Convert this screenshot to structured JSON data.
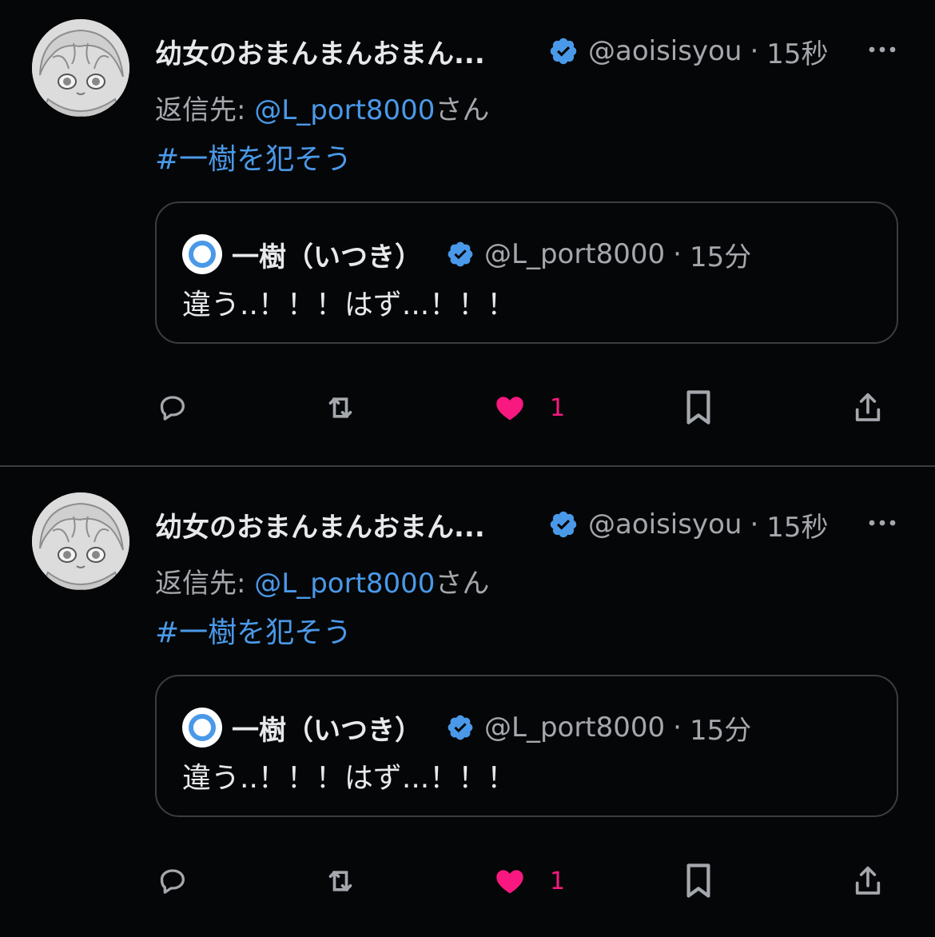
{
  "colors": {
    "background": "#050607",
    "text": "#e7e9ea",
    "secondary_text": "#a4a8ad",
    "link": "#4a99e9",
    "verified": "#4a99e9",
    "like": "#f91880",
    "border": "#3a3d40"
  },
  "tweets": [
    {
      "author": {
        "display_name": "幼女のおまんまんおまん...",
        "handle": "@aoisisyou",
        "verified": true,
        "avatar_icon": "anime-girl-avatar"
      },
      "separator": "·",
      "time": "15秒",
      "reply_to": {
        "prefix": "返信先: ",
        "mention": "@L_port8000",
        "suffix": "さん"
      },
      "text": "#一樹を犯そう",
      "quote": {
        "author": {
          "display_name": "一樹（いつき）",
          "handle": "@L_port8000",
          "verified": true,
          "avatar_icon": "blue-ring-avatar"
        },
        "separator": "·",
        "time": "15分",
        "text": "違う..！！！はず...！！！"
      },
      "actions": {
        "reply_icon": "reply-icon",
        "repost_icon": "repost-icon",
        "like_icon": "heart-icon",
        "like_count": "1",
        "liked": true,
        "bookmark_icon": "bookmark-icon",
        "share_icon": "share-icon"
      }
    },
    {
      "author": {
        "display_name": "幼女のおまんまんおまん...",
        "handle": "@aoisisyou",
        "verified": true,
        "avatar_icon": "anime-girl-avatar"
      },
      "separator": "·",
      "time": "15秒",
      "reply_to": {
        "prefix": "返信先: ",
        "mention": "@L_port8000",
        "suffix": "さん"
      },
      "text": "#一樹を犯そう",
      "quote": {
        "author": {
          "display_name": "一樹（いつき）",
          "handle": "@L_port8000",
          "verified": true,
          "avatar_icon": "blue-ring-avatar"
        },
        "separator": "·",
        "time": "15分",
        "text": "違う..！！！はず...！！！"
      },
      "actions": {
        "reply_icon": "reply-icon",
        "repost_icon": "repost-icon",
        "like_icon": "heart-icon",
        "like_count": "1",
        "liked": true,
        "bookmark_icon": "bookmark-icon",
        "share_icon": "share-icon"
      }
    }
  ]
}
